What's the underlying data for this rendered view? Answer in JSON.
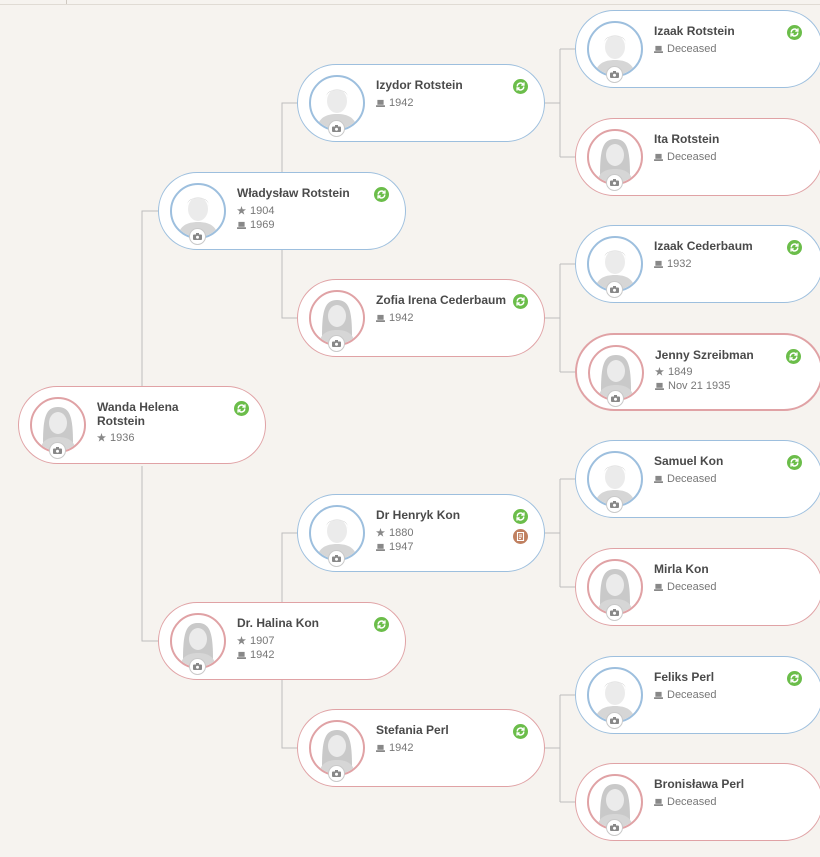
{
  "tree": {
    "root": {
      "name": "Wanda Helena Rotstein",
      "birth": "1936"
    },
    "father": {
      "name": "Władysław Rotstein",
      "birth": "1904",
      "death": "1969"
    },
    "mother": {
      "name": "Dr. Halina Kon",
      "birth": "1907",
      "death": "1942"
    },
    "pat_grandfather": {
      "name": "Izydor Rotstein",
      "death": "1942"
    },
    "pat_grandmother": {
      "name": "Zofia Irena Cederbaum",
      "death": "1942"
    },
    "mat_grandfather": {
      "name": "Dr Henryk Kon",
      "birth": "1880",
      "death": "1947"
    },
    "mat_grandmother": {
      "name": "Stefania Perl",
      "death": "1942"
    },
    "gg1": {
      "name": "Izaak Rotstein",
      "death": "Deceased"
    },
    "gg2": {
      "name": "Ita Rotstein",
      "death": "Deceased"
    },
    "gg3": {
      "name": "Izaak Cederbaum",
      "death": "1932"
    },
    "gg4": {
      "name": "Jenny Szreibman",
      "birth": "1849",
      "death": "Nov 21 1935"
    },
    "gg5": {
      "name": "Samuel Kon",
      "death": "Deceased"
    },
    "gg6": {
      "name": "Mirla Kon",
      "death": "Deceased"
    },
    "gg7": {
      "name": "Feliks Perl",
      "death": "Deceased"
    },
    "gg8": {
      "name": "Bronisława Perl",
      "death": "Deceased"
    }
  },
  "icons": {
    "birth": "star-icon",
    "death": "tombstone-icon",
    "smart_match": "sync-icon",
    "record": "document-icon",
    "photo": "camera-icon"
  },
  "colors": {
    "male_border": "#9dbfde",
    "female_border": "#e0a2a5",
    "sync_badge": "#6bbd4a",
    "record_badge": "#c08060",
    "background": "#f6f3ef"
  }
}
